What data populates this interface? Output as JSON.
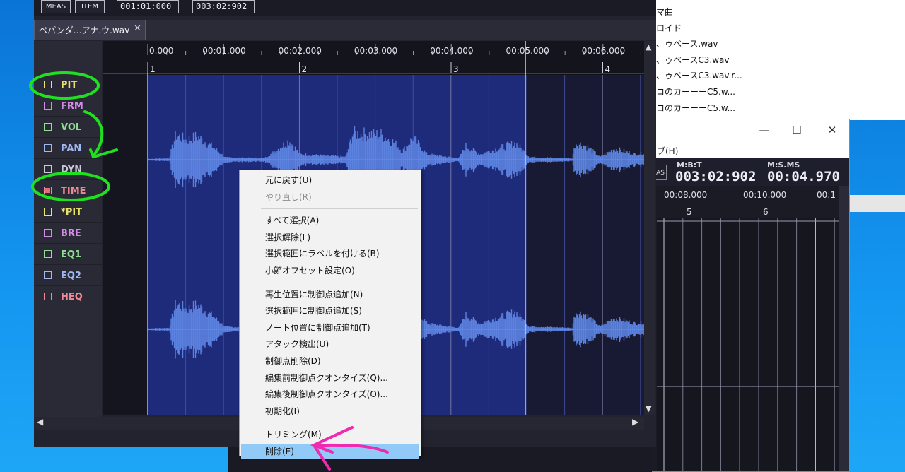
{
  "file_list": {
    "items": [
      "マ曲",
      "ロイド",
      "、ゥベース.wav",
      "、ゥベースC3.wav",
      "、ゥベースC3.wav.r...",
      "コのカーーーC5.w...",
      "コのカーーーC5.w..."
    ]
  },
  "window2": {
    "minimize": "—",
    "maximize": "☐",
    "close": "✕",
    "menu_label": "ブ(H)",
    "meas_label": "AS",
    "time": {
      "mbt_label": "M:B:T",
      "mbt_value": "003:02:902",
      "msms_label": "M:S.MS",
      "msms_value": "00:04.970"
    },
    "ruler_times": [
      "00:08.000",
      "00:10.000",
      "00:1"
    ],
    "ruler_bars": [
      "5",
      "6"
    ]
  },
  "toolbar": {
    "meas_label": "MEAS",
    "item_label": "ITEM",
    "range_start": "001:01:000",
    "range_sep": "–",
    "range_end": "003:02:902"
  },
  "tab": {
    "label": "ペパンダ…アナ.ウ.wav",
    "close": "✕"
  },
  "tracks": [
    {
      "name": "PIT",
      "color": "#e9e36a",
      "checked": false
    },
    {
      "name": "FRM",
      "color": "#d58ce8",
      "checked": false
    },
    {
      "name": "VOL",
      "color": "#8fe08f",
      "checked": false
    },
    {
      "name": "PAN",
      "color": "#9fb8f2",
      "checked": false
    },
    {
      "name": "DYN",
      "color": "#c9c9d8",
      "checked": false
    },
    {
      "name": "TIME",
      "color": "#f08a96",
      "checked": true
    },
    {
      "name": "*PIT",
      "color": "#e9e36a",
      "checked": false
    },
    {
      "name": "BRE",
      "color": "#d58ce8",
      "checked": false
    },
    {
      "name": "EQ1",
      "color": "#8fe08f",
      "checked": false
    },
    {
      "name": "EQ2",
      "color": "#9fb8f2",
      "checked": false
    },
    {
      "name": "HEQ",
      "color": "#f08a96",
      "checked": false
    }
  ],
  "ruler": {
    "times": [
      "0.000",
      "00:01.000",
      "00:02.000",
      "00:03.000",
      "00:04.000",
      "00:05.000",
      "00:06.000"
    ],
    "bars": [
      "1",
      "2",
      "3",
      "4"
    ]
  },
  "scroll": {
    "up": "▲",
    "down": "▼",
    "left": "◀",
    "right": "▶"
  },
  "context_menu": {
    "groups": [
      [
        {
          "label": "元に戻す(U)",
          "enabled": true
        },
        {
          "label": "やり直し(R)",
          "enabled": false
        }
      ],
      [
        {
          "label": "すべて選択(A)",
          "enabled": true
        },
        {
          "label": "選択解除(L)",
          "enabled": true
        },
        {
          "label": "選択範囲にラベルを付ける(B)",
          "enabled": true
        },
        {
          "label": "小節オフセット設定(O)",
          "enabled": true
        }
      ],
      [
        {
          "label": "再生位置に制御点追加(N)",
          "enabled": true
        },
        {
          "label": "選択範囲に制御点追加(S)",
          "enabled": true
        },
        {
          "label": "ノート位置に制御点追加(T)",
          "enabled": true
        },
        {
          "label": "アタック検出(U)",
          "enabled": true
        },
        {
          "label": "制御点削除(D)",
          "enabled": true
        },
        {
          "label": "編集前制御点クオンタイズ(Q)...",
          "enabled": true
        },
        {
          "label": "編集後制御点クオンタイズ(O)...",
          "enabled": true
        },
        {
          "label": "初期化(I)",
          "enabled": true
        }
      ],
      [
        {
          "label": "トリミング(M)",
          "enabled": true
        },
        {
          "label": "削除(E)",
          "enabled": true,
          "highlighted": true
        }
      ]
    ]
  },
  "colors": {
    "waveform": "#5c82e0",
    "selection": "#1e2a7a",
    "annotation_green": "#1fe21f",
    "annotation_pink": "#f02ab0",
    "menu_highlight": "#91c9f7"
  }
}
